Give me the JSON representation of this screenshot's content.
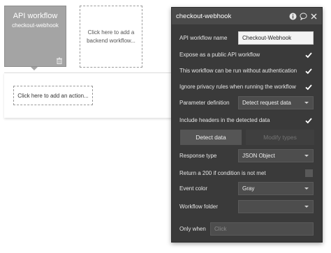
{
  "canvas": {
    "workflow_card": {
      "title": "API workflow",
      "subtitle": "checkout-webhook"
    },
    "add_backend": "Click here to add a backend workflow...",
    "add_action": "Click here to add an action..."
  },
  "panel": {
    "title": "checkout-webhook",
    "rows": {
      "api_workflow_name": {
        "label": "API workflow name",
        "value": "Checkout-Webhook"
      },
      "expose_public": {
        "label": "Expose as a public API workflow",
        "checked": true
      },
      "without_auth": {
        "label": "This workflow can be run without authentication",
        "checked": true
      },
      "ignore_privacy": {
        "label": "Ignore privacy rules when running the workflow",
        "checked": true
      },
      "parameter_definition": {
        "label": "Parameter definition",
        "value": "Detect request data"
      },
      "include_headers": {
        "label": "Include headers in the detected data",
        "checked": true
      },
      "response_type": {
        "label": "Response type",
        "value": "JSON Object"
      },
      "return_200": {
        "label": "Return a 200 if condition is not met",
        "checked": false
      },
      "event_color": {
        "label": "Event color",
        "value": "Gray"
      },
      "workflow_folder": {
        "label": "Workflow folder",
        "value": ""
      },
      "only_when": {
        "label": "Only when",
        "placeholder": "Click"
      }
    },
    "buttons": {
      "detect": "Detect data",
      "modify": "Modify types"
    }
  },
  "colors": {
    "panel_bg": "#3a3a3a",
    "panel_header": "#4a4a4a",
    "card_gray": "#a4a4a4",
    "checkmark": "#ffffff"
  },
  "icons": {
    "trash": "trash-icon",
    "info": "info-icon",
    "comment": "comment-icon",
    "close": "close-icon",
    "check": "checkmark-icon"
  }
}
